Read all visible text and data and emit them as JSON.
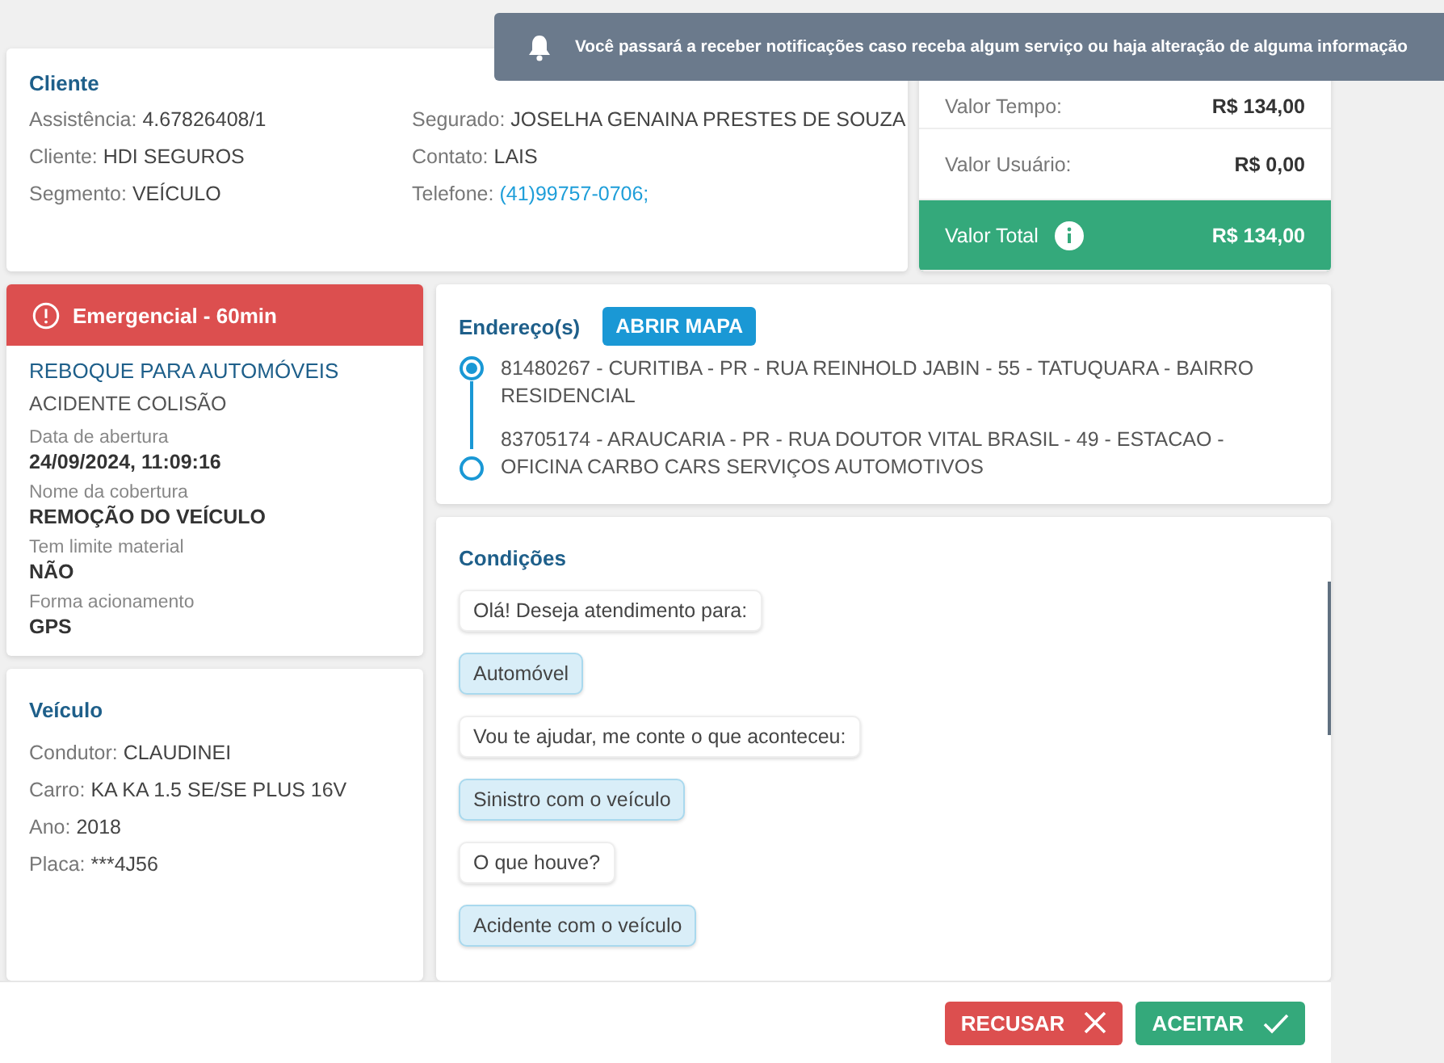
{
  "notification": {
    "text": "Você passará a receber notificações caso receba algum serviço ou haja alteração de alguma informação"
  },
  "client": {
    "title": "Cliente",
    "fields": [
      {
        "label": "Assistência:",
        "value": "4.67826408/1",
        "kind": "plain"
      },
      {
        "label": "Segurado:",
        "value": "JOSELHA GENAINA PRESTES DE SOUZA",
        "kind": "plain"
      },
      {
        "label": "Cliente:",
        "value": "HDI SEGUROS",
        "kind": "plain"
      },
      {
        "label": "Contato:",
        "value": "LAIS",
        "kind": "plain"
      },
      {
        "label": "Segmento:",
        "value": "VEÍCULO",
        "kind": "plain"
      },
      {
        "label": "Telefone:",
        "value": "(41)99757-0706;",
        "kind": "link"
      }
    ]
  },
  "prices": [
    {
      "label": "Valor Tempo:",
      "value": "R$ 134,00",
      "kind": "plain"
    },
    {
      "label": "Valor Usuário:",
      "value": "R$ 0,00",
      "kind": "plain"
    },
    {
      "label": "Valor Total",
      "value": "R$ 134,00",
      "kind": "total"
    }
  ],
  "service": {
    "badge": "Emergencial - 60min",
    "title": "REBOQUE PARA AUTOMÓVEIS",
    "subtitle": "ACIDENTE COLISÃO",
    "details": [
      {
        "label": "Data de abertura",
        "value": "24/09/2024, 11:09:16"
      },
      {
        "label": "Nome da cobertura",
        "value": "REMOÇÃO DO VEÍCULO"
      },
      {
        "label": "Tem limite material",
        "value": "NÃO"
      },
      {
        "label": "Forma acionamento",
        "value": "GPS"
      }
    ]
  },
  "vehicle": {
    "title": "Veículo",
    "fields": [
      {
        "label": "Condutor:",
        "value": "CLAUDINEI"
      },
      {
        "label": "Carro:",
        "value": "KA KA 1.5 SE/SE PLUS 16V"
      },
      {
        "label": "Ano:",
        "value": "2018"
      },
      {
        "label": "Placa:",
        "value": "***4J56"
      }
    ]
  },
  "addresses": {
    "title": "Endereço(s)",
    "map_button": "ABRIR MAPA",
    "items": [
      {
        "text": "81480267 - CURITIBA - PR - RUA REINHOLD JABIN - 55 - TATUQUARA - BAIRRO RESIDENCIAL",
        "kind": "origin"
      },
      {
        "text": "83705174 - ARAUCARIA - PR - RUA DOUTOR VITAL BRASIL - 49 - ESTACAO - OFICINA CARBO CARS SERVIÇOS AUTOMOTIVOS",
        "kind": "destination"
      }
    ]
  },
  "conditions": {
    "title": "Condições",
    "messages": [
      {
        "text": "Olá! Deseja atendimento para:",
        "kind": "question"
      },
      {
        "text": "Automóvel",
        "kind": "answer"
      },
      {
        "text": "Vou te ajudar, me conte o que aconteceu:",
        "kind": "question"
      },
      {
        "text": "Sinistro com o veículo",
        "kind": "answer"
      },
      {
        "text": "O que houve?",
        "kind": "question"
      },
      {
        "text": "Acidente com o veículo",
        "kind": "answer"
      }
    ]
  },
  "actions": [
    {
      "label": "RECUSAR",
      "kind": "reject"
    },
    {
      "label": "ACEITAR",
      "kind": "accept"
    }
  ]
}
